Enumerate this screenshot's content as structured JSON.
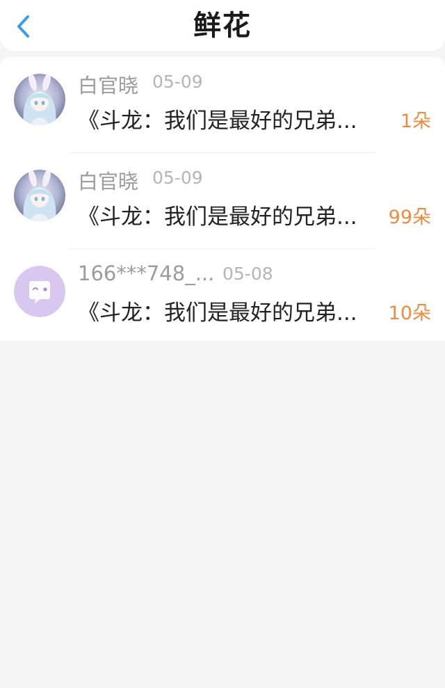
{
  "header": {
    "title": "鲜花"
  },
  "icons": {
    "back": "chevron-left-icon",
    "default_avatar": "chat-bubble-icon"
  },
  "colors": {
    "back_icon": "#3a9bf0",
    "count": "#f08a3e",
    "default_avatar_bg": "#d9c7f0"
  },
  "items": [
    {
      "name": "白官晓",
      "date": "05-09",
      "book": "《斗龙：我们是最好的兄弟...",
      "count": "1朵"
    },
    {
      "name": "白官晓",
      "date": "05-09",
      "book": "《斗龙：我们是最好的兄弟...",
      "count": "99朵"
    },
    {
      "name": "166***748_...",
      "date": "05-08",
      "book": "《斗龙：我们是最好的兄弟...",
      "count": "10朵"
    }
  ]
}
